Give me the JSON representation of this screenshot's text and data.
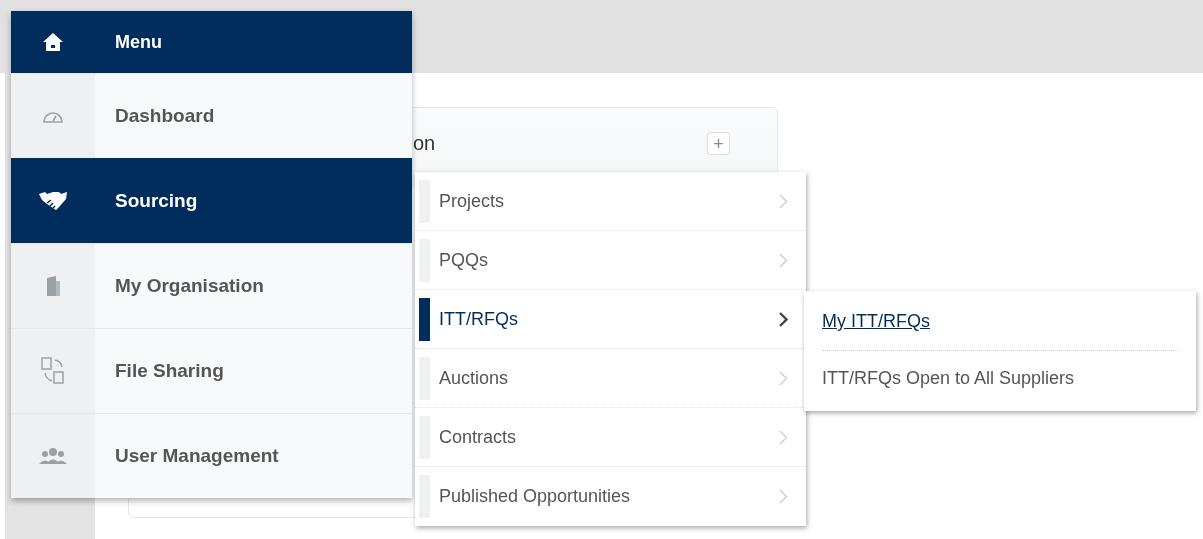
{
  "card": {
    "title": "on",
    "add_label": "+"
  },
  "menu": {
    "title": "Menu",
    "items": [
      {
        "label": "Dashboard",
        "selected": false
      },
      {
        "label": "Sourcing",
        "selected": true
      },
      {
        "label": "My Organisation",
        "selected": false
      },
      {
        "label": "File Sharing",
        "selected": false
      },
      {
        "label": "User Management",
        "selected": false
      }
    ]
  },
  "submenu": {
    "items": [
      {
        "label": "Projects",
        "selected": false
      },
      {
        "label": "PQQs",
        "selected": false
      },
      {
        "label": "ITT/RFQs",
        "selected": true
      },
      {
        "label": "Auctions",
        "selected": false
      },
      {
        "label": "Contracts",
        "selected": false
      },
      {
        "label": "Published Opportunities",
        "selected": false
      }
    ]
  },
  "flyout": {
    "items": [
      {
        "label": "My ITT/RFQs",
        "kind": "link"
      },
      {
        "label": "ITT/RFQs Open to All Suppliers",
        "kind": "plain"
      }
    ]
  }
}
